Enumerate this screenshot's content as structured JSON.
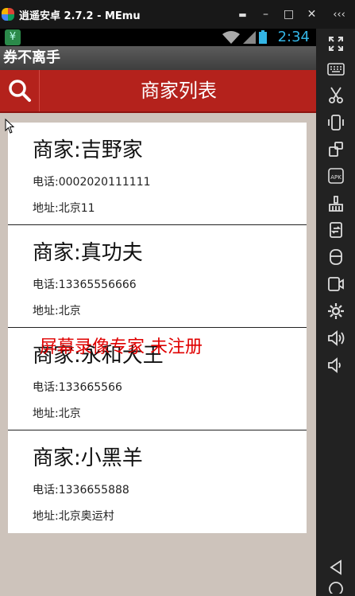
{
  "window": {
    "title": "逍遥安卓 2.7.2 - MEmu",
    "controls": [
      "‹‹‹",
      "▬",
      "–",
      "□",
      "×"
    ]
  },
  "status_bar": {
    "time": "2:34"
  },
  "app": {
    "title": "券不离手",
    "header_title": "商家列表"
  },
  "merchants": [
    {
      "name": "商家:吉野家",
      "phone": "电话:0002020111111",
      "address": "地址:北京11"
    },
    {
      "name": "商家:真功夫",
      "phone": "电话:13365556666",
      "address": "地址:北京"
    },
    {
      "name": "商家:永和大王",
      "phone": "电话:133665566",
      "address": "地址:北京"
    },
    {
      "name": "商家:小黑羊",
      "phone": "电话:1336655888",
      "address": "地址:北京奥运村"
    }
  ],
  "watermark": "屏幕录像专家  未注册",
  "sidebar": {
    "buttons": [
      "fullscreen-icon",
      "keyboard-icon",
      "scissors-icon",
      "shake-icon",
      "rotate-icon",
      "apk-icon",
      "broom-icon",
      "transfer-icon",
      "storage-icon",
      "record-icon",
      "settings-icon",
      "volume-up-icon",
      "volume-down-icon",
      "back-icon",
      "home-icon"
    ],
    "apk_label": "APK"
  }
}
